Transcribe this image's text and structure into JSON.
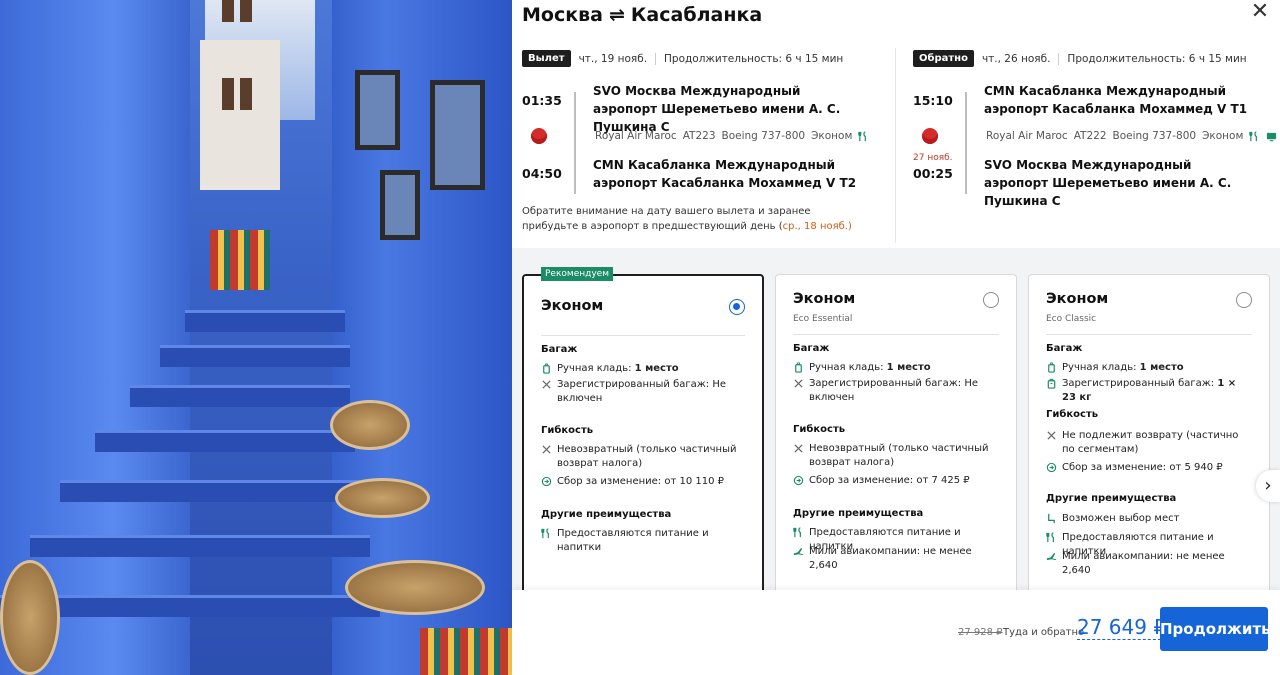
{
  "route": {
    "from": "Москва",
    "to": "Касабланка",
    "arrow": "⇌"
  },
  "outbound": {
    "tag": "Вылет",
    "date": "чт., 19 нояб.",
    "duration": "Продолжительность: 6 ч 15 мин",
    "dep_time": "01:35",
    "dep_airport": "SVO Москва Международный аэропорт Шереметьево имени А. С. Пушкина C",
    "airline": "Royal Air Maroc",
    "flight": "AT223",
    "aircraft": "Boeing 737-800",
    "cabin": "Эконом",
    "arr_time": "04:50",
    "arr_airport": "CMN Касабланка Международный аэропорт Касабланка Мохаммед V T2"
  },
  "return": {
    "tag": "Обратно",
    "date": "чт., 26 нояб.",
    "duration": "Продолжительность: 6 ч 15 мин",
    "dep_time": "15:10",
    "dep_airport": "CMN Касабланка Международный аэропорт Касабланка Мохаммед V T1",
    "airline": "Royal Air Maroc",
    "flight": "AT222",
    "aircraft": "Boeing 737-800",
    "cabin": "Эконом",
    "arr_date": "27 нояб.",
    "arr_time": "00:25",
    "arr_airport": "SVO Москва Международный аэропорт Шереметьево имени А. С. Пушкина C"
  },
  "notice": {
    "text": "Обратите внимание на дату вашего вылета и заранее прибудьте в аэропорт в предшествующий день (",
    "date": "ср., 18 нояб.",
    "close": ")"
  },
  "fares": [
    {
      "badge": "Рекомендуем",
      "name": "Эконом",
      "subname": "",
      "selected": true,
      "baggage_title": "Багаж",
      "hand": "Ручная кладь: ",
      "hand_value": "1 место",
      "checked": "Зарегистрированный багаж: Не включен",
      "flex_title": "Гибкость",
      "refund": "Невозвратный (только частичный возврат налога)",
      "change": "Сбор за изменение: от 10 110 ₽",
      "other_title": "Другие преимущества",
      "other": [
        "Предоставляются питание и напитки"
      ]
    },
    {
      "badge": "",
      "name": "Эконом",
      "subname": "Eco Essential",
      "selected": false,
      "baggage_title": "Багаж",
      "hand": "Ручная кладь: ",
      "hand_value": "1 место",
      "checked": "Зарегистрированный багаж: Не включен",
      "flex_title": "Гибкость",
      "refund": "Невозвратный (только частичный возврат налога)",
      "change": "Сбор за изменение: от 7 425 ₽",
      "other_title": "Другие преимущества",
      "other": [
        "Предоставляются питание и напитки",
        "Мили авиакомпании: не менее 2,640"
      ]
    },
    {
      "badge": "",
      "name": "Эконом",
      "subname": "Eco Classic",
      "selected": false,
      "baggage_title": "Багаж",
      "hand": "Ручная кладь: ",
      "hand_value": "1 место",
      "checked": "Зарегистрированный багаж: ",
      "checked_value": "1 × 23 кг",
      "flex_title": "Гибкость",
      "refund": "Не подлежит возврату (частично по сегментам)",
      "change": "Сбор за изменение: от 5 940 ₽",
      "other_title": "Другие преимущества",
      "other": [
        "Возможен выбор мест",
        "Предоставляются питание и напитки",
        "Мили авиакомпании: не менее 2,640"
      ]
    }
  ],
  "footer": {
    "old_price": "27 928 ₽",
    "label": "Туда и обратно",
    "price": "27 649 ₽",
    "cta": "Продолжить"
  },
  "colors": {
    "accent": "#1565d8",
    "recommend": "#1a8c66",
    "warning": "#d25b13"
  }
}
